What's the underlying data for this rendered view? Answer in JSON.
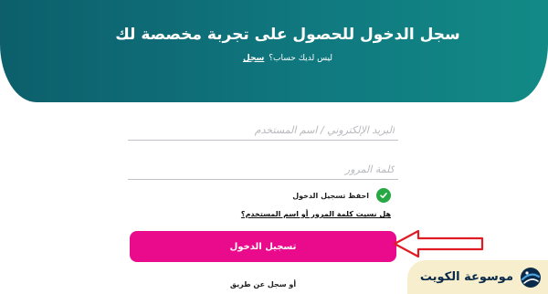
{
  "hero": {
    "title": "سجل الدخول للحصول على تجربة مخصصة لك",
    "subtitle_text": "ليس لديك حساب؟",
    "subtitle_link": "سجل"
  },
  "form": {
    "email_placeholder": "البريد الإلكتروني / اسم المستخدم",
    "password_placeholder": "كلمة المرور",
    "remember_label": "احفظ تسجيل الدخول",
    "forgot_link": "هل نسيت كلمة المرور أو اسم المستخدم؟",
    "login_button": "تسجيل الدخول",
    "alt_signin": "أو سجل عن طريق"
  },
  "watermark": {
    "text": "موسوعة الكويت"
  },
  "colors": {
    "hero_start": "#0c5f6b",
    "hero_end": "#128a86",
    "accent_pink": "#ea0a8c",
    "check_green": "#27a844",
    "arrow_red": "#e01b24"
  }
}
